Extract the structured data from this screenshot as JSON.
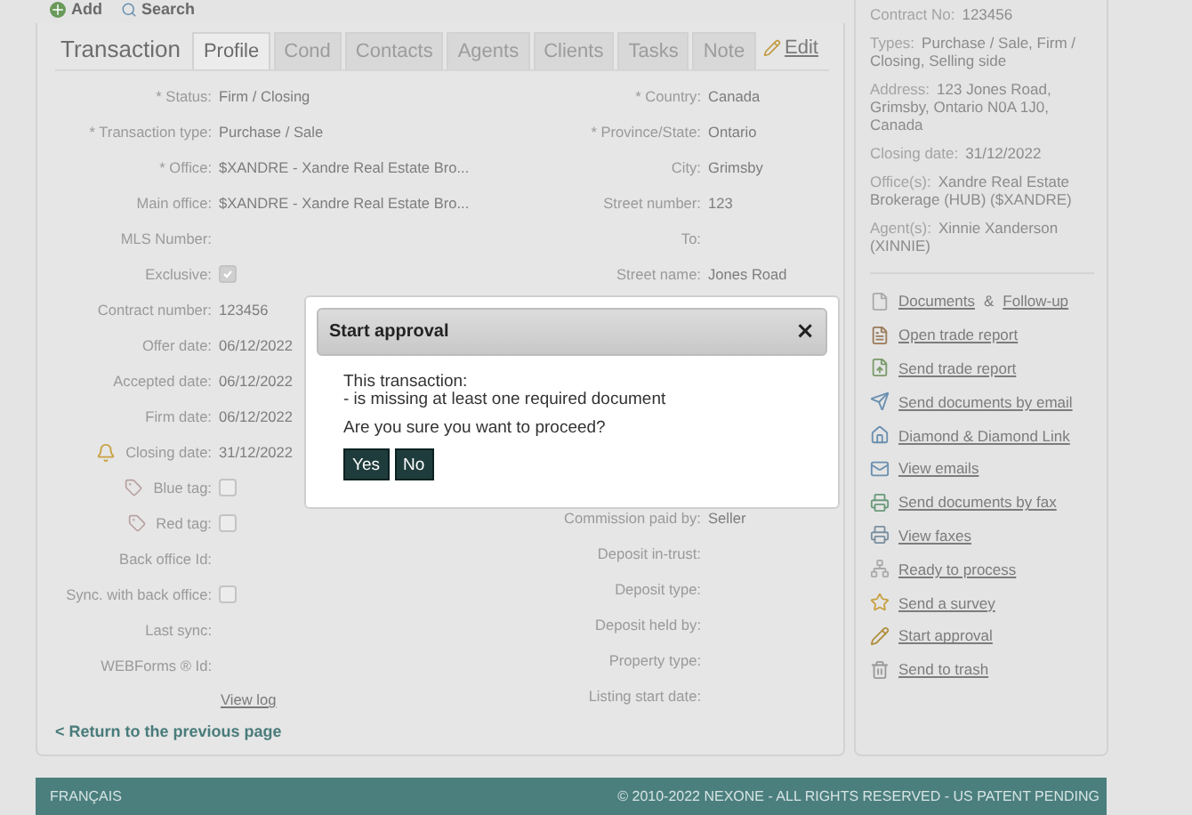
{
  "toolbar": [
    {
      "label": "Add",
      "kind": "add"
    },
    {
      "label": "Search",
      "kind": "search"
    }
  ],
  "panel_title": "Transaction",
  "tabs": [
    {
      "label": "Profile",
      "selected": true
    },
    {
      "label": "Cond",
      "selected": false
    },
    {
      "label": "Contacts",
      "selected": false
    },
    {
      "label": "Agents",
      "selected": false
    },
    {
      "label": "Clients",
      "selected": false
    },
    {
      "label": "Tasks",
      "selected": false
    },
    {
      "label": "Note",
      "selected": false
    }
  ],
  "edit_link": "Edit",
  "left_fields": [
    {
      "label": "* Status:",
      "value": "Firm / Closing",
      "kind": "text"
    },
    {
      "label": "* Transaction type:",
      "value": "Purchase / Sale",
      "kind": "text"
    },
    {
      "label": "* Office:",
      "value": "$XANDRE - Xandre Real Estate Bro...",
      "kind": "text"
    },
    {
      "label": "Main office:",
      "value": "$XANDRE - Xandre Real Estate Bro...",
      "kind": "text"
    },
    {
      "label": "MLS Number:",
      "kind": "text"
    },
    {
      "label": "Exclusive:",
      "kind": "checkbox",
      "checked": true
    },
    {
      "label": "Contract number:",
      "value": "123456",
      "kind": "text"
    },
    {
      "label": "Offer date:",
      "value": "06/12/2022",
      "kind": "text"
    },
    {
      "label": "Accepted date:",
      "value": "06/12/2022",
      "kind": "text"
    },
    {
      "label": "Firm date:",
      "value": "06/12/2022",
      "kind": "text"
    },
    {
      "label": "Closing date:",
      "value": "31/12/2022",
      "kind": "alert-text"
    },
    {
      "label": "Blue tag:",
      "kind": "tag-checkbox",
      "checked": false
    },
    {
      "label": "Red tag:",
      "kind": "tag-checkbox",
      "checked": false
    },
    {
      "label": "Back office Id:",
      "kind": "text"
    },
    {
      "label": "Sync. with back office:",
      "kind": "checkbox",
      "checked": false
    },
    {
      "label": "Last sync:",
      "kind": "text"
    },
    {
      "label": "WEBForms ® Id:",
      "kind": "text"
    }
  ],
  "view_log": "View log",
  "right_fields": [
    {
      "label": "* Country:",
      "value": "Canada"
    },
    {
      "label": "* Province/State:",
      "value": "Ontario"
    },
    {
      "label": "City:",
      "value": "Grimsby"
    },
    {
      "label": "Street number:",
      "value": "123"
    },
    {
      "label": "To:"
    },
    {
      "label": "Street name:",
      "value": "Jones Road"
    }
  ],
  "right_fields_lower": [
    {
      "label": "Commission paid by:",
      "value": "Seller"
    },
    {
      "label": "Deposit in-trust:"
    },
    {
      "label": "Deposit type:"
    },
    {
      "label": "Deposit held by:"
    },
    {
      "label": "Property type:"
    },
    {
      "label": "Listing start date:"
    }
  ],
  "return_link": "< Return to the previous page",
  "summary": [
    {
      "label": "Contract No:",
      "value": "123456"
    },
    {
      "label": "Types:",
      "value": "Purchase / Sale, Firm / Closing, Selling side"
    },
    {
      "label": "Address:",
      "value": "123 Jones Road, Grimsby, Ontario N0A 1J0, Canada"
    },
    {
      "label": "Closing date:",
      "value": "31/12/2022"
    },
    {
      "label": "Office(s):",
      "value": "Xandre Real Estate Brokerage (HUB) ($XANDRE)"
    },
    {
      "label": "Agent(s):",
      "value": "Xinnie Xanderson (XINNIE)"
    }
  ],
  "actions": [
    {
      "kind": "documents",
      "label": "Documents",
      "joiner": "&",
      "label_2": "Follow-up"
    },
    {
      "kind": "report",
      "label": "Open trade report"
    },
    {
      "kind": "send-report",
      "label": "Send trade report"
    },
    {
      "kind": "email",
      "label": "Send documents by email"
    },
    {
      "kind": "house",
      "label": "Diamond & Diamond Link"
    },
    {
      "kind": "mail",
      "label": "View emails"
    },
    {
      "kind": "fax",
      "label": "Send documents by fax"
    },
    {
      "kind": "printer",
      "label": "View faxes"
    },
    {
      "kind": "network",
      "label": "Ready to process"
    },
    {
      "kind": "survey",
      "label": "Send a survey"
    },
    {
      "kind": "pen",
      "label": "Start approval"
    },
    {
      "kind": "trash",
      "label": "Send to trash"
    }
  ],
  "footer": {
    "language": "FRANÇAIS",
    "copyright": "© 2010-2022 NEXONE - ALL RIGHTS RESERVED - US PATENT PENDING"
  },
  "dialog": {
    "title": "Start approval",
    "close": "×",
    "message_1": "This transaction:",
    "message_2": "- is missing at least one required document",
    "question": "Are you sure you want to proceed?",
    "buttons": [
      "Yes",
      "No"
    ]
  }
}
